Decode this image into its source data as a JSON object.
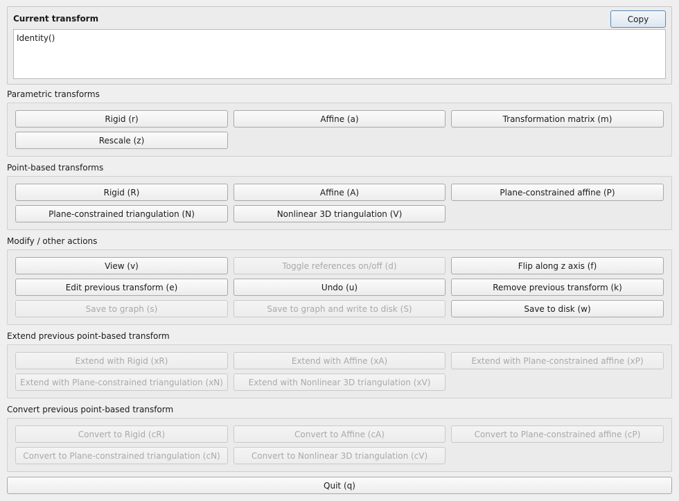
{
  "current_transform": {
    "title": "Current transform",
    "copy_label": "Copy",
    "value": "Identity()"
  },
  "parametric": {
    "label": "Parametric transforms",
    "buttons": [
      "Rigid (r)",
      "Affine (a)",
      "Transformation matrix (m)",
      "Rescale (z)"
    ]
  },
  "point_based": {
    "label": "Point-based transforms",
    "buttons": [
      "Rigid (R)",
      "Affine (A)",
      "Plane-constrained affine (P)",
      "Plane-constrained triangulation (N)",
      "Nonlinear 3D triangulation (V)"
    ]
  },
  "modify": {
    "label": "Modify / other actions",
    "buttons": [
      "View (v)",
      "Toggle references on/off (d)",
      "Flip along z axis (f)",
      "Edit previous transform (e)",
      "Undo (u)",
      "Remove previous transform (k)",
      "Save to graph (s)",
      "Save to graph and write to disk (S)",
      "Save to disk (w)"
    ]
  },
  "extend": {
    "label": "Extend previous point-based transform",
    "buttons": [
      "Extend with Rigid (xR)",
      "Extend with Affine (xA)",
      "Extend with Plane-constrained affine (xP)",
      "Extend with Plane-constrained triangulation (xN)",
      "Extend with Nonlinear 3D triangulation (xV)"
    ]
  },
  "convert": {
    "label": "Convert previous point-based transform",
    "buttons": [
      "Convert to Rigid (cR)",
      "Convert to Affine (cA)",
      "Convert to Plane-constrained affine (cP)",
      "Convert to Plane-constrained triangulation (cN)",
      "Convert to Nonlinear 3D triangulation (cV)"
    ]
  },
  "quit_label": "Quit (q)"
}
